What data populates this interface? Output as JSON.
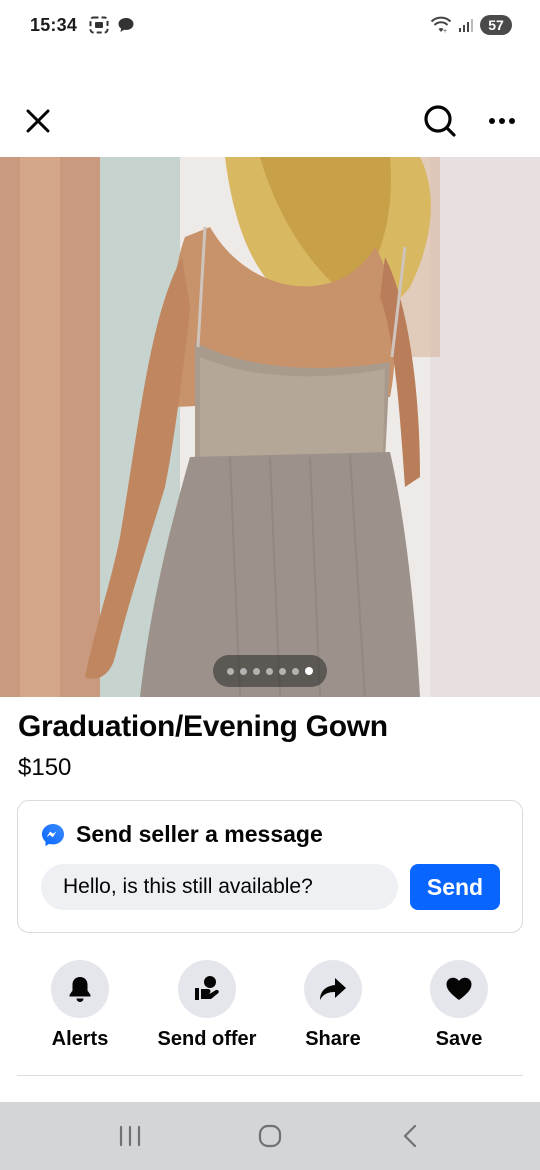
{
  "status_bar": {
    "time": "15:34",
    "battery": "57",
    "icons": [
      "screenshot-icon",
      "chat-bubble-icon",
      "wifi-icon",
      "signal-icon"
    ]
  },
  "app_bar": {
    "close_icon": "close-icon",
    "search_icon": "search-icon",
    "more_icon": "more-icon"
  },
  "photo": {
    "page_count": 7,
    "current_page": 7
  },
  "listing": {
    "title": "Graduation/Evening Gown",
    "price": "$150"
  },
  "message": {
    "heading": "Send seller a message",
    "input_value": "Hello, is this still available?",
    "send_label": "Send"
  },
  "actions": [
    {
      "label": "Alerts",
      "icon": "bell-icon"
    },
    {
      "label": "Send offer",
      "icon": "offer-icon"
    },
    {
      "label": "Share",
      "icon": "share-icon"
    },
    {
      "label": "Save",
      "icon": "heart-icon"
    }
  ],
  "nav_bar": {
    "icons": [
      "recents-icon",
      "home-icon",
      "back-icon"
    ]
  },
  "colors": {
    "accent": "#0866ff",
    "action_bg": "#e4e6eb",
    "input_bg": "#eef0f3",
    "nav_bg": "#d4d5d7"
  }
}
